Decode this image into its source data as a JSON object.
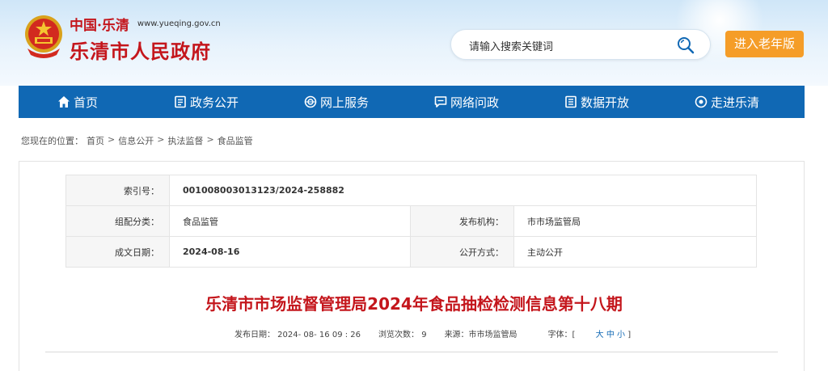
{
  "header": {
    "brand_country": "中国·乐清",
    "brand_url": "www.yueqing.gov.cn",
    "brand_title": "乐清市人民政府",
    "search_placeholder": "请输入搜索关键词",
    "elder_button": "进入老年版",
    "elder_color": "#f59d28",
    "brand_color": "#c4161c"
  },
  "nav": {
    "color": "#1068b4",
    "items": [
      {
        "label": "首页",
        "icon": "home-icon"
      },
      {
        "label": "政务公开",
        "icon": "document-icon"
      },
      {
        "label": "网上服务",
        "icon": "globe-icon"
      },
      {
        "label": "网络问政",
        "icon": "chat-icon"
      },
      {
        "label": "数据开放",
        "icon": "database-icon"
      },
      {
        "label": "走进乐清",
        "icon": "eye-icon"
      }
    ]
  },
  "breadcrumb": {
    "prefix": "您现在的位置：",
    "items": [
      "首页",
      "信息公开",
      "执法监督",
      "食品监管"
    ]
  },
  "info": {
    "index_label": "索引号：",
    "index_value": "001008003013123/2024-258882",
    "category_label": "组配分类：",
    "category_value": "食品监管",
    "org_label": "发布机构：",
    "org_value": "市市场监管局",
    "date_label": "成文日期：",
    "date_value": "2024-08-16",
    "method_label": "公开方式：",
    "method_value": "主动公开"
  },
  "article": {
    "title": "乐清市市场监督管理局2024年食品抽检检测信息第十八期",
    "publish_date": "发布日期： 2024- 08- 16 09 : 26",
    "views": "浏览次数： 9",
    "source": "来源：市市场监管局",
    "font_label": "字体：[",
    "font_large": "大",
    "font_medium": "中",
    "font_small": "小",
    "font_close": "]"
  }
}
